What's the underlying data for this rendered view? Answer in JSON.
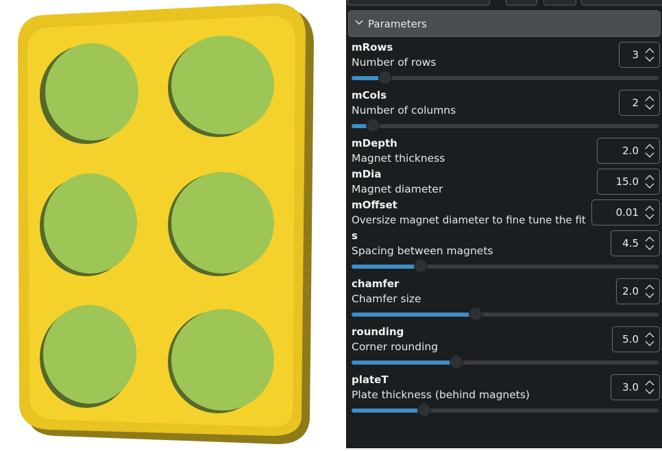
{
  "viewport": {
    "plate_color": "#f4d22b",
    "plate_side_color": "#8f7a1a",
    "magnet_color": "#9dc656",
    "magnet_shadow_color": "#55692a"
  },
  "panel": {
    "section_title": "Parameters",
    "chevron_icon": "chevron-down-icon",
    "params": [
      {
        "name": "mRows",
        "desc": "Number of rows",
        "value": "3",
        "slider_fraction": 0.11
      },
      {
        "name": "mCols",
        "desc": "Number of columns",
        "value": "2",
        "slider_fraction": 0.07
      },
      {
        "name": "mDepth",
        "desc": "Magnet thickness",
        "value": "2.0"
      },
      {
        "name": "mDia",
        "desc": "Magnet diameter",
        "value": "15.0"
      },
      {
        "name": "mOffset",
        "desc": "Oversize magnet diameter to fine tune the fit",
        "value": "0.01"
      },
      {
        "name": "s",
        "desc": "Spacing between magnets",
        "value": "4.5",
        "slider_fraction": 0.225
      },
      {
        "name": "chamfer",
        "desc": "Chamfer size",
        "value": "2.0",
        "slider_fraction": 0.405
      },
      {
        "name": "rounding",
        "desc": "Corner rounding",
        "value": "5.0",
        "slider_fraction": 0.342
      },
      {
        "name": "plateT",
        "desc": "Plate thickness (behind magnets)",
        "value": "3.0",
        "slider_fraction": 0.236
      }
    ]
  }
}
